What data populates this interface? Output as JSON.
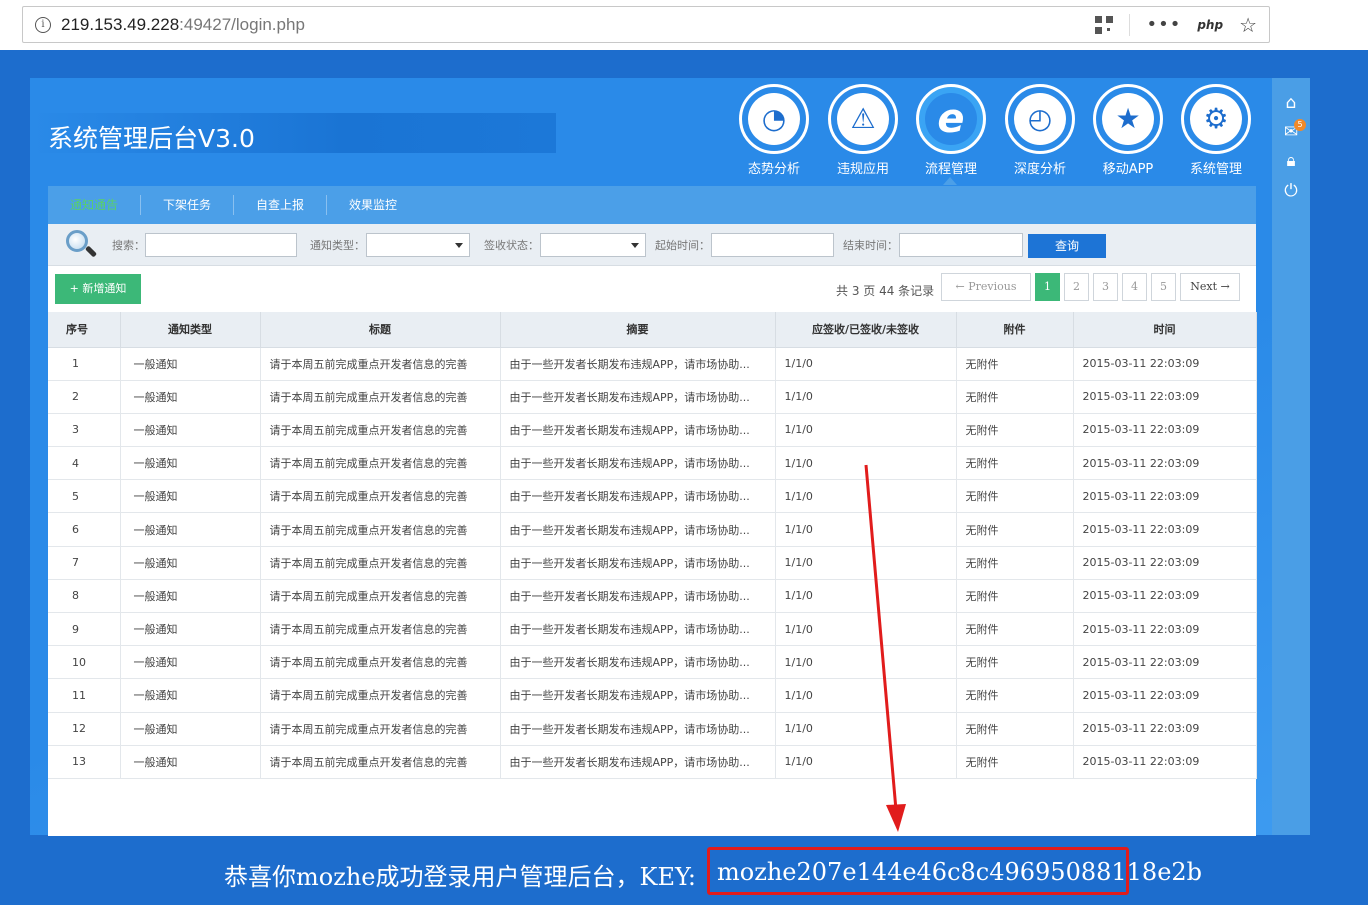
{
  "browser": {
    "url_host": "219.153.49.228",
    "url_rest": ":49427/login.php",
    "ext_label": "php",
    "menu_dots": "•••"
  },
  "header": {
    "title": "系统管理后台V3.0"
  },
  "modules": [
    {
      "label": "态势分析",
      "icon": "pie-chart-icon"
    },
    {
      "label": "违规应用",
      "icon": "warning-icon"
    },
    {
      "label": "流程管理",
      "icon": "ie-icon"
    },
    {
      "label": "深度分析",
      "icon": "gauge-icon"
    },
    {
      "label": "移动APP",
      "icon": "star-badge-icon"
    },
    {
      "label": "系统管理",
      "icon": "settings-window-icon"
    }
  ],
  "sidebar": {
    "mail_badge": "5"
  },
  "tabs": [
    "通知通告",
    "下架任务",
    "自查上报",
    "效果监控"
  ],
  "filters": {
    "search_label": "搜索：",
    "type_label": "通知类型：",
    "status_label": "签收状态：",
    "start_label": "起始时间：",
    "end_label": "结束时间：",
    "query_button": "查询"
  },
  "toolbar": {
    "add_button": "+ 新增通知",
    "records_text": "共 3 页 44 条记录"
  },
  "pagination": {
    "prev": "← Previous",
    "pages": [
      "1",
      "2",
      "3",
      "4",
      "5"
    ],
    "next": "Next →"
  },
  "table": {
    "headers": [
      "序号",
      "通知类型",
      "标题",
      "摘要",
      "应签收/已签收/未签收",
      "附件",
      "时间"
    ],
    "rows": [
      [
        "1",
        "一般通知",
        "请于本周五前完成重点开发者信息的完善",
        "由于一些开发者长期发布违规APP，请市场协助...",
        "1/1/0",
        "无附件",
        "2015-03-11 22:03:09"
      ],
      [
        "2",
        "一般通知",
        "请于本周五前完成重点开发者信息的完善",
        "由于一些开发者长期发布违规APP，请市场协助...",
        "1/1/0",
        "无附件",
        "2015-03-11 22:03:09"
      ],
      [
        "3",
        "一般通知",
        "请于本周五前完成重点开发者信息的完善",
        "由于一些开发者长期发布违规APP，请市场协助...",
        "1/1/0",
        "无附件",
        "2015-03-11 22:03:09"
      ],
      [
        "4",
        "一般通知",
        "请于本周五前完成重点开发者信息的完善",
        "由于一些开发者长期发布违规APP，请市场协助...",
        "1/1/0",
        "无附件",
        "2015-03-11 22:03:09"
      ],
      [
        "5",
        "一般通知",
        "请于本周五前完成重点开发者信息的完善",
        "由于一些开发者长期发布违规APP，请市场协助...",
        "1/1/0",
        "无附件",
        "2015-03-11 22:03:09"
      ],
      [
        "6",
        "一般通知",
        "请于本周五前完成重点开发者信息的完善",
        "由于一些开发者长期发布违规APP，请市场协助...",
        "1/1/0",
        "无附件",
        "2015-03-11 22:03:09"
      ],
      [
        "7",
        "一般通知",
        "请于本周五前完成重点开发者信息的完善",
        "由于一些开发者长期发布违规APP，请市场协助...",
        "1/1/0",
        "无附件",
        "2015-03-11 22:03:09"
      ],
      [
        "8",
        "一般通知",
        "请于本周五前完成重点开发者信息的完善",
        "由于一些开发者长期发布违规APP，请市场协助...",
        "1/1/0",
        "无附件",
        "2015-03-11 22:03:09"
      ],
      [
        "9",
        "一般通知",
        "请于本周五前完成重点开发者信息的完善",
        "由于一些开发者长期发布违规APP，请市场协助...",
        "1/1/0",
        "无附件",
        "2015-03-11 22:03:09"
      ],
      [
        "10",
        "一般通知",
        "请于本周五前完成重点开发者信息的完善",
        "由于一些开发者长期发布违规APP，请市场协助...",
        "1/1/0",
        "无附件",
        "2015-03-11 22:03:09"
      ],
      [
        "11",
        "一般通知",
        "请于本周五前完成重点开发者信息的完善",
        "由于一些开发者长期发布违规APP，请市场协助...",
        "1/1/0",
        "无附件",
        "2015-03-11 22:03:09"
      ],
      [
        "12",
        "一般通知",
        "请于本周五前完成重点开发者信息的完善",
        "由于一些开发者长期发布违规APP，请市场协助...",
        "1/1/0",
        "无附件",
        "2015-03-11 22:03:09"
      ],
      [
        "13",
        "一般通知",
        "请于本周五前完成重点开发者信息的完善",
        "由于一些开发者长期发布违规APP，请市场协助...",
        "1/1/0",
        "无附件",
        "2015-03-11 22:03:09"
      ]
    ]
  },
  "banner": {
    "message": "恭喜你mozhe成功登录用户管理后台，KEY:",
    "key": "mozhe207e144e46c8c49695088118e2b"
  },
  "colors": {
    "brand_blue": "#1d6dcd",
    "accent_green": "#3cb878",
    "highlight_red": "#e11c1c"
  }
}
